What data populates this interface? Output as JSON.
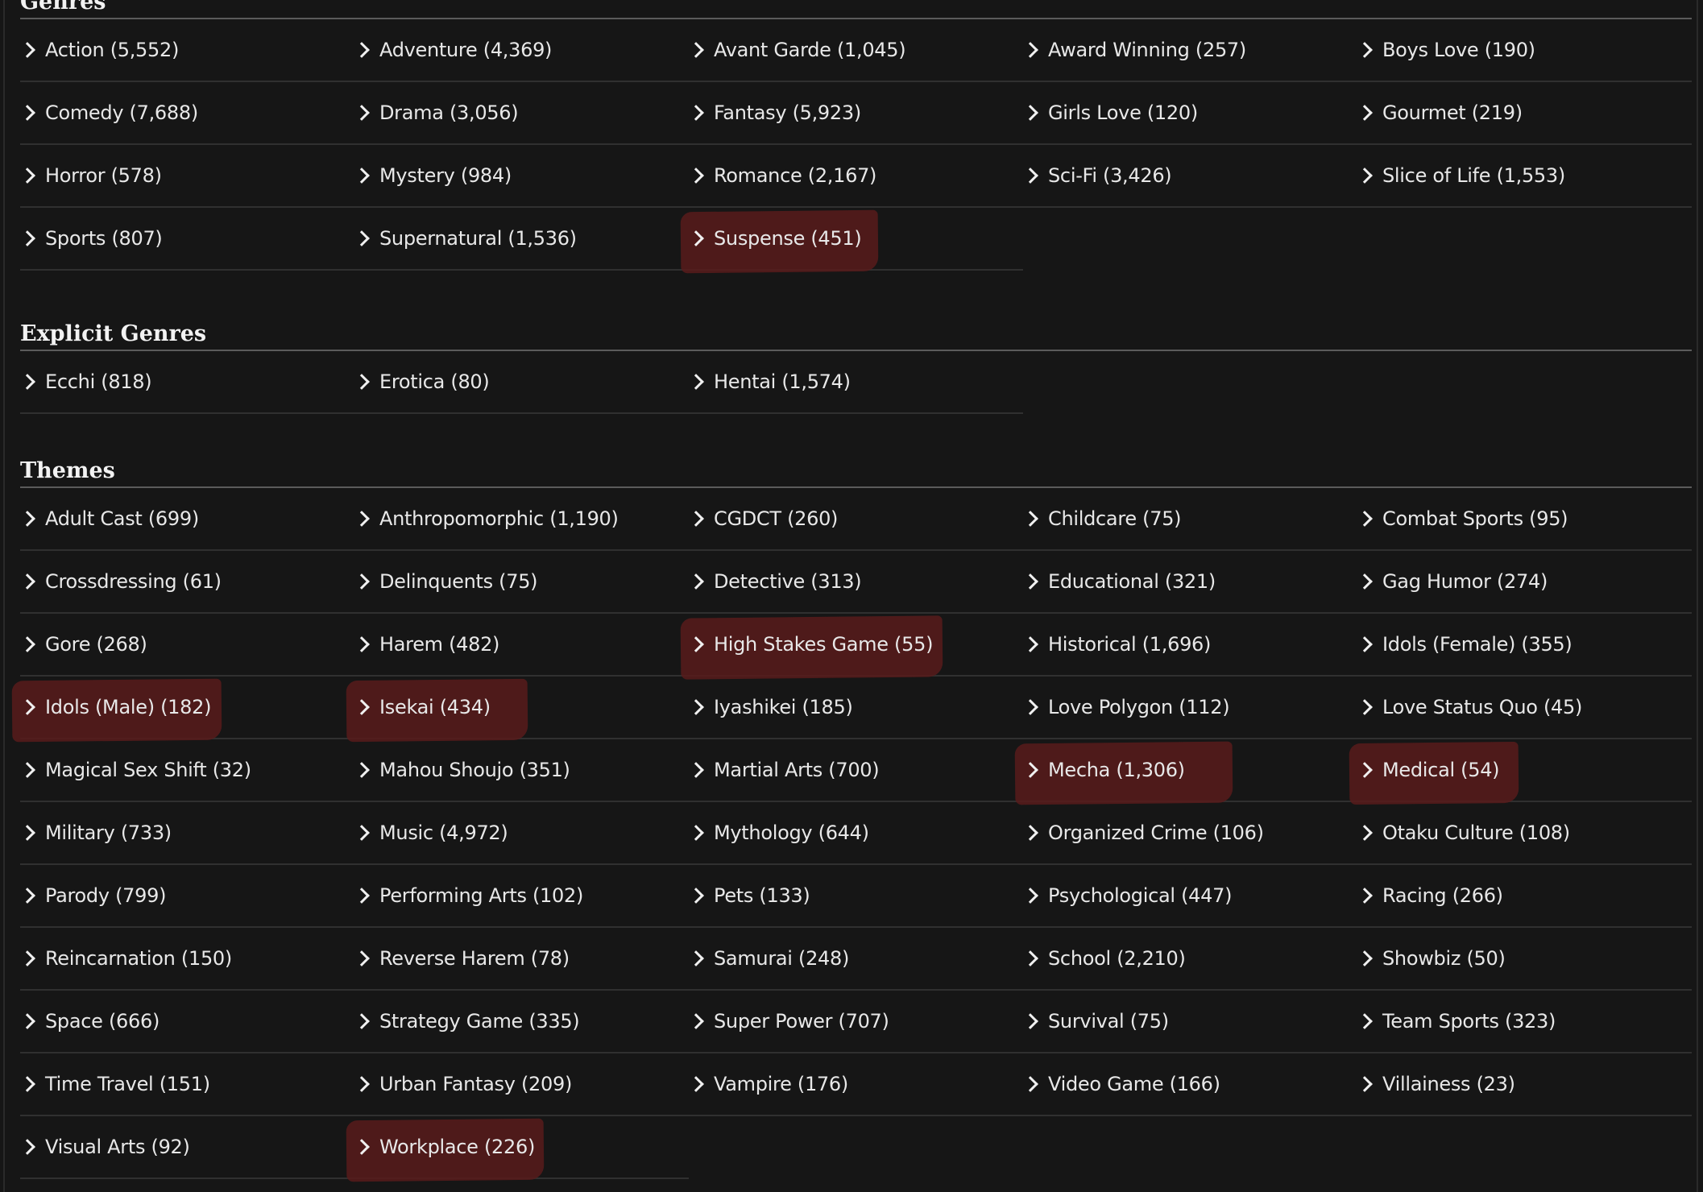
{
  "sections": [
    {
      "title": "Genres",
      "items": [
        {
          "label": "Action (5,552)",
          "highlighted": false
        },
        {
          "label": "Adventure (4,369)",
          "highlighted": false
        },
        {
          "label": "Avant Garde (1,045)",
          "highlighted": false
        },
        {
          "label": "Award Winning (257)",
          "highlighted": false
        },
        {
          "label": "Boys Love (190)",
          "highlighted": false
        },
        {
          "label": "Comedy (7,688)",
          "highlighted": false
        },
        {
          "label": "Drama (3,056)",
          "highlighted": false
        },
        {
          "label": "Fantasy (5,923)",
          "highlighted": false
        },
        {
          "label": "Girls Love (120)",
          "highlighted": false
        },
        {
          "label": "Gourmet (219)",
          "highlighted": false
        },
        {
          "label": "Horror (578)",
          "highlighted": false
        },
        {
          "label": "Mystery (984)",
          "highlighted": false
        },
        {
          "label": "Romance (2,167)",
          "highlighted": false
        },
        {
          "label": "Sci-Fi (3,426)",
          "highlighted": false
        },
        {
          "label": "Slice of Life (1,553)",
          "highlighted": false
        },
        {
          "label": "Sports (807)",
          "highlighted": false
        },
        {
          "label": "Supernatural (1,536)",
          "highlighted": false
        },
        {
          "label": "Suspense (451)",
          "highlighted": true
        }
      ]
    },
    {
      "title": "Explicit Genres",
      "items": [
        {
          "label": "Ecchi (818)",
          "highlighted": false
        },
        {
          "label": "Erotica (80)",
          "highlighted": false
        },
        {
          "label": "Hentai (1,574)",
          "highlighted": false
        }
      ]
    },
    {
      "title": "Themes",
      "items": [
        {
          "label": "Adult Cast (699)",
          "highlighted": false
        },
        {
          "label": "Anthropomorphic (1,190)",
          "highlighted": false
        },
        {
          "label": "CGDCT (260)",
          "highlighted": false
        },
        {
          "label": "Childcare (75)",
          "highlighted": false
        },
        {
          "label": "Combat Sports (95)",
          "highlighted": false
        },
        {
          "label": "Crossdressing (61)",
          "highlighted": false
        },
        {
          "label": "Delinquents (75)",
          "highlighted": false
        },
        {
          "label": "Detective (313)",
          "highlighted": false
        },
        {
          "label": "Educational (321)",
          "highlighted": false
        },
        {
          "label": "Gag Humor (274)",
          "highlighted": false
        },
        {
          "label": "Gore (268)",
          "highlighted": false
        },
        {
          "label": "Harem (482)",
          "highlighted": false
        },
        {
          "label": "High Stakes Game (55)",
          "highlighted": true
        },
        {
          "label": "Historical (1,696)",
          "highlighted": false
        },
        {
          "label": "Idols (Female) (355)",
          "highlighted": false
        },
        {
          "label": "Idols (Male) (182)",
          "highlighted": true
        },
        {
          "label": "Isekai (434)",
          "highlighted": true
        },
        {
          "label": "Iyashikei (185)",
          "highlighted": false
        },
        {
          "label": "Love Polygon (112)",
          "highlighted": false
        },
        {
          "label": "Love Status Quo (45)",
          "highlighted": false
        },
        {
          "label": "Magical Sex Shift (32)",
          "highlighted": false
        },
        {
          "label": "Mahou Shoujo (351)",
          "highlighted": false
        },
        {
          "label": "Martial Arts (700)",
          "highlighted": false
        },
        {
          "label": "Mecha (1,306)",
          "highlighted": true
        },
        {
          "label": "Medical (54)",
          "highlighted": true
        },
        {
          "label": "Military (733)",
          "highlighted": false
        },
        {
          "label": "Music (4,972)",
          "highlighted": false
        },
        {
          "label": "Mythology (644)",
          "highlighted": false
        },
        {
          "label": "Organized Crime (106)",
          "highlighted": false
        },
        {
          "label": "Otaku Culture (108)",
          "highlighted": false
        },
        {
          "label": "Parody (799)",
          "highlighted": false
        },
        {
          "label": "Performing Arts (102)",
          "highlighted": false
        },
        {
          "label": "Pets (133)",
          "highlighted": false
        },
        {
          "label": "Psychological (447)",
          "highlighted": false
        },
        {
          "label": "Racing (266)",
          "highlighted": false
        },
        {
          "label": "Reincarnation (150)",
          "highlighted": false
        },
        {
          "label": "Reverse Harem (78)",
          "highlighted": false
        },
        {
          "label": "Samurai (248)",
          "highlighted": false
        },
        {
          "label": "School (2,210)",
          "highlighted": false
        },
        {
          "label": "Showbiz (50)",
          "highlighted": false
        },
        {
          "label": "Space (666)",
          "highlighted": false
        },
        {
          "label": "Strategy Game (335)",
          "highlighted": false
        },
        {
          "label": "Super Power (707)",
          "highlighted": false
        },
        {
          "label": "Survival (75)",
          "highlighted": false
        },
        {
          "label": "Team Sports (323)",
          "highlighted": false
        },
        {
          "label": "Time Travel (151)",
          "highlighted": false
        },
        {
          "label": "Urban Fantasy (209)",
          "highlighted": false
        },
        {
          "label": "Vampire (176)",
          "highlighted": false
        },
        {
          "label": "Video Game (166)",
          "highlighted": false
        },
        {
          "label": "Villainess (23)",
          "highlighted": false
        },
        {
          "label": "Visual Arts (92)",
          "highlighted": false
        },
        {
          "label": "Workplace (226)",
          "highlighted": true
        }
      ]
    }
  ],
  "colors": {
    "background": "#161616",
    "text": "#e8e8e8",
    "highlight": "#561b1b",
    "row_divider": "#303030",
    "heading_rule": "#5b5b5b"
  },
  "icons": {
    "item_icon": "chevron-right-icon"
  }
}
